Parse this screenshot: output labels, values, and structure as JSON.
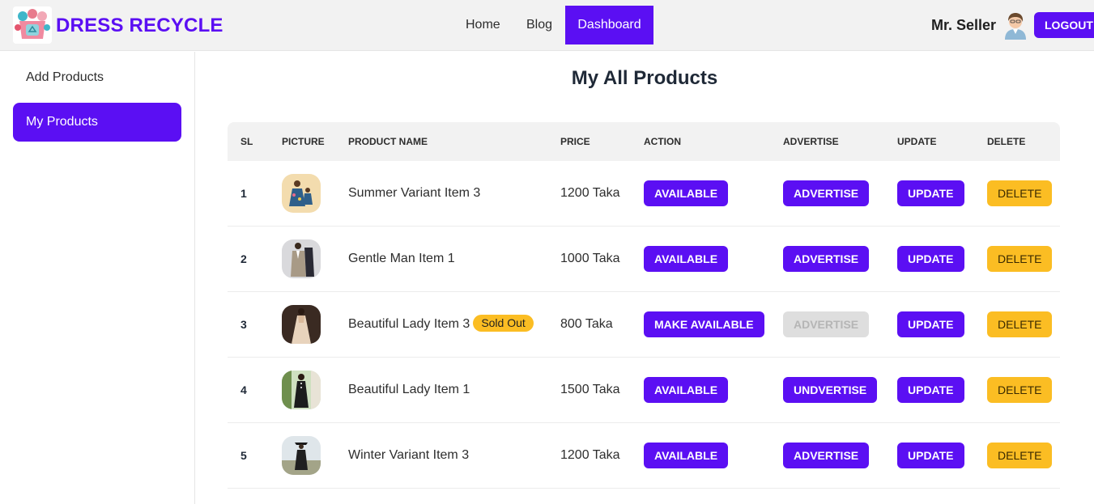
{
  "brand": {
    "name": "DRESS RECYCLE",
    "logo_icon": "recycle-logo-icon"
  },
  "nav": {
    "home": "Home",
    "blog": "Blog",
    "dashboard": "Dashboard"
  },
  "user": {
    "name": "Mr. Seller",
    "avatar_icon": "user-avatar-icon",
    "logout": "LOGOUT"
  },
  "sidebar": {
    "items": [
      {
        "label": "Add Products"
      },
      {
        "label": "My Products"
      }
    ]
  },
  "page": {
    "title": "My All Products"
  },
  "table": {
    "headers": {
      "sl": "SL",
      "picture": "PICTURE",
      "name": "PRODUCT NAME",
      "price": "PRICE",
      "action": "ACTION",
      "advertise": "ADVERTISE",
      "update": "UPDATE",
      "delete": "DELETE"
    },
    "rows": [
      {
        "sl": "1",
        "name": "Summer Variant Item 3",
        "badge": "",
        "price": "1200 Taka",
        "action": "AVAILABLE",
        "advertise": "ADVERTISE",
        "advertise_disabled": false,
        "update": "UPDATE",
        "delete": "DELETE"
      },
      {
        "sl": "2",
        "name": "Gentle Man Item 1",
        "badge": "",
        "price": "1000 Taka",
        "action": "AVAILABLE",
        "advertise": "ADVERTISE",
        "advertise_disabled": false,
        "update": "UPDATE",
        "delete": "DELETE"
      },
      {
        "sl": "3",
        "name": "Beautiful Lady Item 3",
        "badge": "Sold Out",
        "price": "800 Taka",
        "action": "MAKE AVAILABLE",
        "advertise": "ADVERTISE",
        "advertise_disabled": true,
        "update": "UPDATE",
        "delete": "DELETE"
      },
      {
        "sl": "4",
        "name": "Beautiful Lady Item 1",
        "badge": "",
        "price": "1500 Taka",
        "action": "AVAILABLE",
        "advertise": "UNDVERTISE",
        "advertise_disabled": false,
        "update": "UPDATE",
        "delete": "DELETE"
      },
      {
        "sl": "5",
        "name": "Winter Variant Item 3",
        "badge": "",
        "price": "1200 Taka",
        "action": "AVAILABLE",
        "advertise": "ADVERTISE",
        "advertise_disabled": false,
        "update": "UPDATE",
        "delete": "DELETE"
      }
    ]
  },
  "colors": {
    "primary": "#5b0ff3",
    "warning": "#fbbd23",
    "navbar_bg": "#f2f2f2"
  }
}
